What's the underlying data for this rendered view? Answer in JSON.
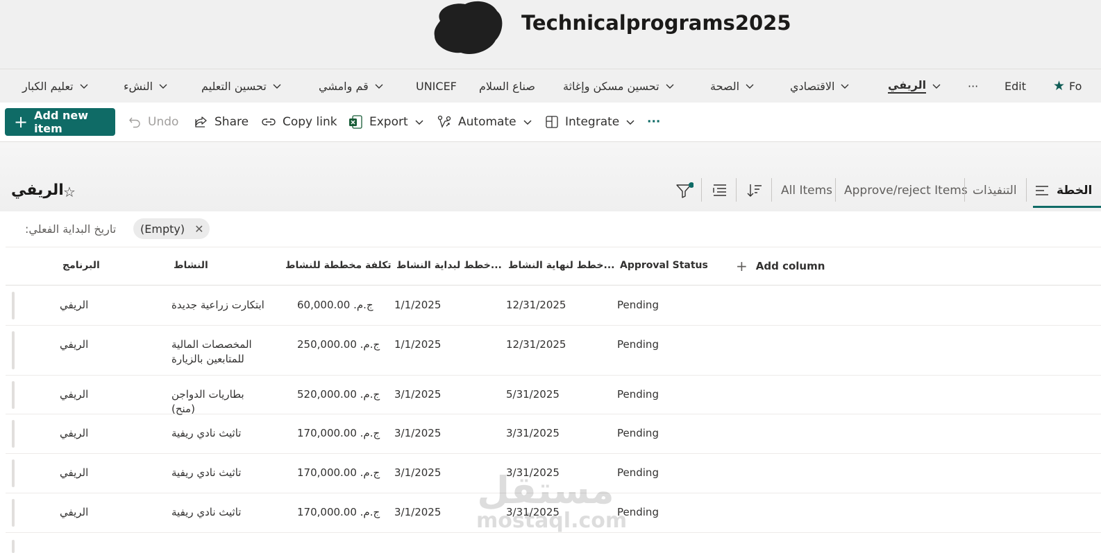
{
  "site": {
    "title": "Technicalprograms2025"
  },
  "top_nav": {
    "items": [
      {
        "label": "تعليم الكبار",
        "chevron": true,
        "active": false
      },
      {
        "label": "النشء",
        "chevron": true,
        "active": false
      },
      {
        "label": "تحسين التعليم",
        "chevron": true,
        "active": false
      },
      {
        "label": "قم وامشي",
        "chevron": true,
        "active": false
      },
      {
        "label": "UNICEF",
        "chevron": false,
        "active": false
      },
      {
        "label": "صناع السلام",
        "chevron": false,
        "active": false
      },
      {
        "label": "تحسين مسكن وإغاثة",
        "chevron": true,
        "active": false
      },
      {
        "label": "الصحة",
        "chevron": true,
        "active": false
      },
      {
        "label": "الاقتصادي",
        "chevron": true,
        "active": false
      },
      {
        "label": "الريفي",
        "chevron": true,
        "active": true
      }
    ],
    "more_label": "···",
    "edit_label": "Edit",
    "follow_label": "Fo",
    "follow_icon": "star-filled-icon"
  },
  "command_bar": {
    "add_new_item": "Add new item",
    "undo": "Undo",
    "share": "Share",
    "copy_link": "Copy link",
    "export": "Export",
    "automate": "Automate",
    "integrate": "Integrate",
    "more": "···"
  },
  "view_bar": {
    "list_title": "الريفي",
    "views": [
      {
        "label": "الخطة",
        "active": true
      },
      {
        "label": "التنفيذات",
        "active": false
      },
      {
        "label": "Approve/reject Items",
        "active": false
      },
      {
        "label": "All Items",
        "active": false
      }
    ]
  },
  "filter": {
    "field_label": "تاريخ البداية الفعلي:",
    "value": "(Empty)",
    "remove_symbol": "✕"
  },
  "grid": {
    "columns": [
      {
        "key": "program",
        "label": "البرنامج"
      },
      {
        "key": "activity",
        "label": "النشاط"
      },
      {
        "key": "cost",
        "label": "تكلفة مخططة للنشاط"
      },
      {
        "key": "start",
        "label": "...خطط لبداية النشاط"
      },
      {
        "key": "end",
        "label": "...خطط لنهاية النشاط"
      },
      {
        "key": "status",
        "label": "Approval Status"
      }
    ],
    "add_column_label": "Add column",
    "rows": [
      {
        "program": "الريفي",
        "activity": "ابتكارت زراعية جديدة",
        "cost": "ج.م. 60,000.00",
        "start": "1/1/2025",
        "end": "12/31/2025",
        "status": "Pending"
      },
      {
        "program": "الريفي",
        "activity": "المخصصات المالية للمتابعين بالزيارة",
        "cost": "ج.م. 250,000.00",
        "start": "1/1/2025",
        "end": "12/31/2025",
        "status": "Pending"
      },
      {
        "program": "الريفي",
        "activity": "بطاريات الدواجن (منح)",
        "cost": "ج.م. 520,000.00",
        "start": "3/1/2025",
        "end": "5/31/2025",
        "status": "Pending"
      },
      {
        "program": "الريفي",
        "activity": "تاثيث نادي ريفية",
        "cost": "ج.م. 170,000.00",
        "start": "3/1/2025",
        "end": "3/31/2025",
        "status": "Pending"
      },
      {
        "program": "الريفي",
        "activity": "تاثيث نادي ريفية",
        "cost": "ج.م. 170,000.00",
        "start": "3/1/2025",
        "end": "3/31/2025",
        "status": "Pending"
      },
      {
        "program": "الريفي",
        "activity": "تاثيث نادي ريفية",
        "cost": "ج.م. 170,000.00",
        "start": "3/1/2025",
        "end": "3/31/2025",
        "status": "Pending"
      },
      {
        "program": "",
        "activity": "",
        "cost": "",
        "start": "",
        "end": "",
        "status": ""
      }
    ]
  },
  "watermark": {
    "arabic": "مستقل",
    "latin": "mostaql.com"
  },
  "colors": {
    "accent": "#0f6b66",
    "header_bg": "#f0f0f0",
    "logo_blot": "#1f1f1f"
  }
}
